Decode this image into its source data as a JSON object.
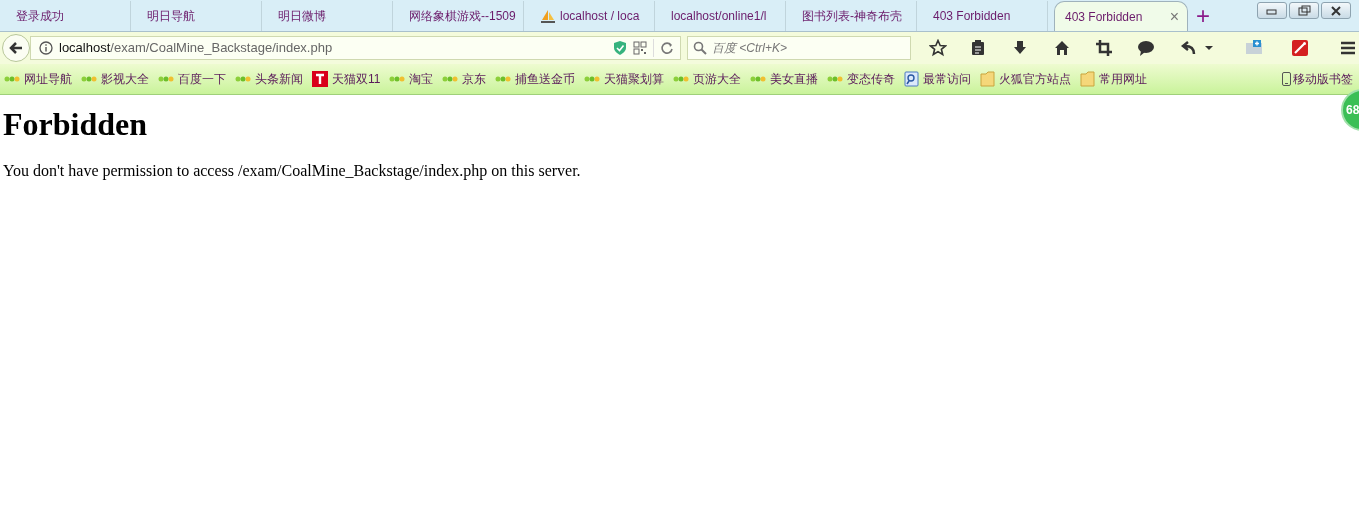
{
  "tabs": [
    {
      "title": "登录成功",
      "selected": false
    },
    {
      "title": "明日导航",
      "selected": false
    },
    {
      "title": "明日微博",
      "selected": false
    },
    {
      "title": "网络象棋游戏--1509",
      "selected": false
    },
    {
      "title": "localhost / loca",
      "selected": false
    },
    {
      "title": "localhost/online1/l",
      "selected": false
    },
    {
      "title": "图书列表-神奇布壳",
      "selected": false
    },
    {
      "title": "403 Forbidden",
      "selected": false
    },
    {
      "title": "403 Forbidden",
      "selected": true
    }
  ],
  "new_tab": "+",
  "tab_close": "×",
  "address": {
    "host": "localhost",
    "path": "/exam/CoalMine_Backstage/index.php"
  },
  "search": {
    "placeholder": "百度 <Ctrl+K>"
  },
  "bookmarks": [
    {
      "label": "网址导航",
      "kind": "site"
    },
    {
      "label": "影视大全",
      "kind": "site"
    },
    {
      "label": "百度一下",
      "kind": "site"
    },
    {
      "label": "头条新闻",
      "kind": "site"
    },
    {
      "label": "天猫双11",
      "kind": "tmall"
    },
    {
      "label": "淘宝",
      "kind": "site"
    },
    {
      "label": "京东",
      "kind": "site"
    },
    {
      "label": "捕鱼送金币",
      "kind": "site"
    },
    {
      "label": "天猫聚划算",
      "kind": "site"
    },
    {
      "label": "页游大全",
      "kind": "site"
    },
    {
      "label": "美女直播",
      "kind": "site"
    },
    {
      "label": "变态传奇",
      "kind": "site"
    },
    {
      "label": "最常访问",
      "kind": "history"
    },
    {
      "label": "火狐官方站点",
      "kind": "folder"
    },
    {
      "label": "常用网址",
      "kind": "folder"
    }
  ],
  "mobile_bookmarks": "移动版书签",
  "badge": "68",
  "page": {
    "heading": "Forbidden",
    "message": "You don't have permission to access /exam/CoalMine_Backstage/index.php on this server."
  }
}
